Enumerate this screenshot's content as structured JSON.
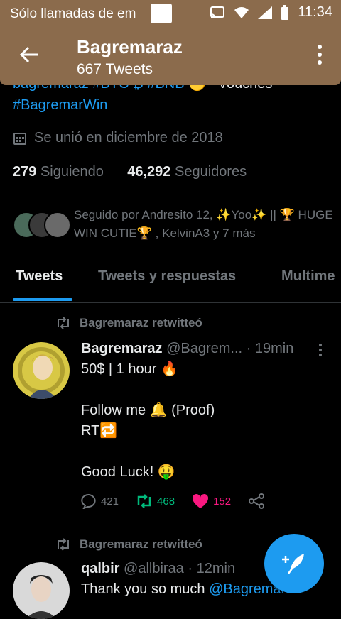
{
  "status_bar": {
    "notification": "Sólo llamadas de em",
    "time": "11:34"
  },
  "header": {
    "title": "Bagremaraz",
    "subtitle": "667 Tweets"
  },
  "profile": {
    "bio_partial": "bagremaraz #BTC ₿  #BNB 🟡",
    "bio_tail": "Vouches",
    "hashtag": "#BagremarWin",
    "joined": "Se unió en diciembre de 2018",
    "following_count": "279",
    "following_label": "Siguiendo",
    "followers_count": "46,292",
    "followers_label": "Seguidores",
    "followed_by": "Seguido por Andresito 12,  ✨Yoo✨ || 🏆 HUGE WIN CUTIE🏆 , KelvinA3 y 7 más"
  },
  "tabs": [
    {
      "label": "Tweets"
    },
    {
      "label": "Tweets y respuestas"
    },
    {
      "label": "Multime"
    }
  ],
  "tweets": [
    {
      "retweet_label": "Bagremaraz retwitteó",
      "name": "Bagremaraz",
      "handle": "@Bagrem...",
      "time": "· 19min",
      "lines": "50$ | 1 hour 🔥\n\nFollow me 🔔 (Proof)\nRT🔁\n\nGood Luck! 🤑",
      "replies": "421",
      "retweets": "468",
      "likes": "152"
    },
    {
      "retweet_label": "Bagremaraz retwitteó",
      "name": "qalbir",
      "handle": "@allbiraa",
      "time": "· 12min",
      "text_start": "Thank you so much ",
      "mention": "@Bagremaraz"
    }
  ],
  "colors": {
    "accent": "#1d9bf0",
    "appbar": "#8b6b4c",
    "retweet": "#00ba7c",
    "like": "#f91880"
  }
}
